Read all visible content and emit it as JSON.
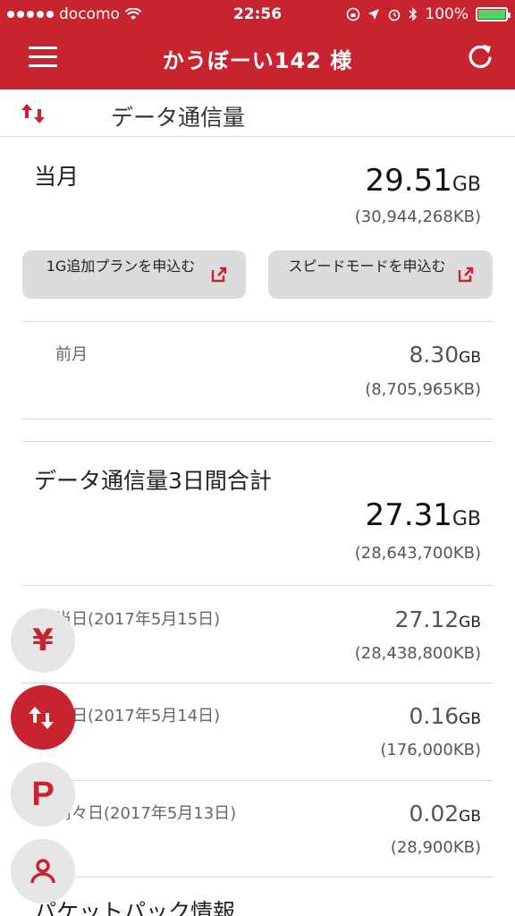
{
  "status_bar": {
    "carrier": "docomo",
    "time": "22:56",
    "battery": "100%"
  },
  "header": {
    "title": "かうぼーい142 様"
  },
  "subheader": {
    "title": "データ通信量"
  },
  "current_month": {
    "label": "当月",
    "value": "29.51",
    "unit": "GB",
    "kb": "(30,944,268KB)",
    "buttons": [
      {
        "label": "1G追加プランを申込む"
      },
      {
        "label": "スピードモードを申込む"
      }
    ]
  },
  "previous_month": {
    "label": "前月",
    "value": "8.30",
    "unit": "GB",
    "kb": "(8,705,965KB)"
  },
  "three_day": {
    "label": "データ通信量3日間合計",
    "value": "27.31",
    "unit": "GB",
    "kb": "(28,643,700KB)",
    "days": [
      {
        "label": "当日(2017年5月15日)",
        "value": "27.12",
        "unit": "GB",
        "kb": "(28,438,800KB)"
      },
      {
        "label": "前日(2017年5月14日)",
        "value": "0.16",
        "unit": "GB",
        "kb": "(176,000KB)"
      },
      {
        "label": "前々日(2017年5月13日)",
        "value": "0.02",
        "unit": "GB",
        "kb": "(28,900KB)"
      }
    ]
  },
  "next_section": {
    "label": "パケットパック情報"
  },
  "colors": {
    "brand": "#c8242f",
    "button_bg": "#dcdcdc"
  },
  "fabs": [
    {
      "icon": "yen-icon"
    },
    {
      "icon": "data-transfer-icon"
    },
    {
      "icon": "p-icon"
    },
    {
      "icon": "person-icon"
    }
  ]
}
